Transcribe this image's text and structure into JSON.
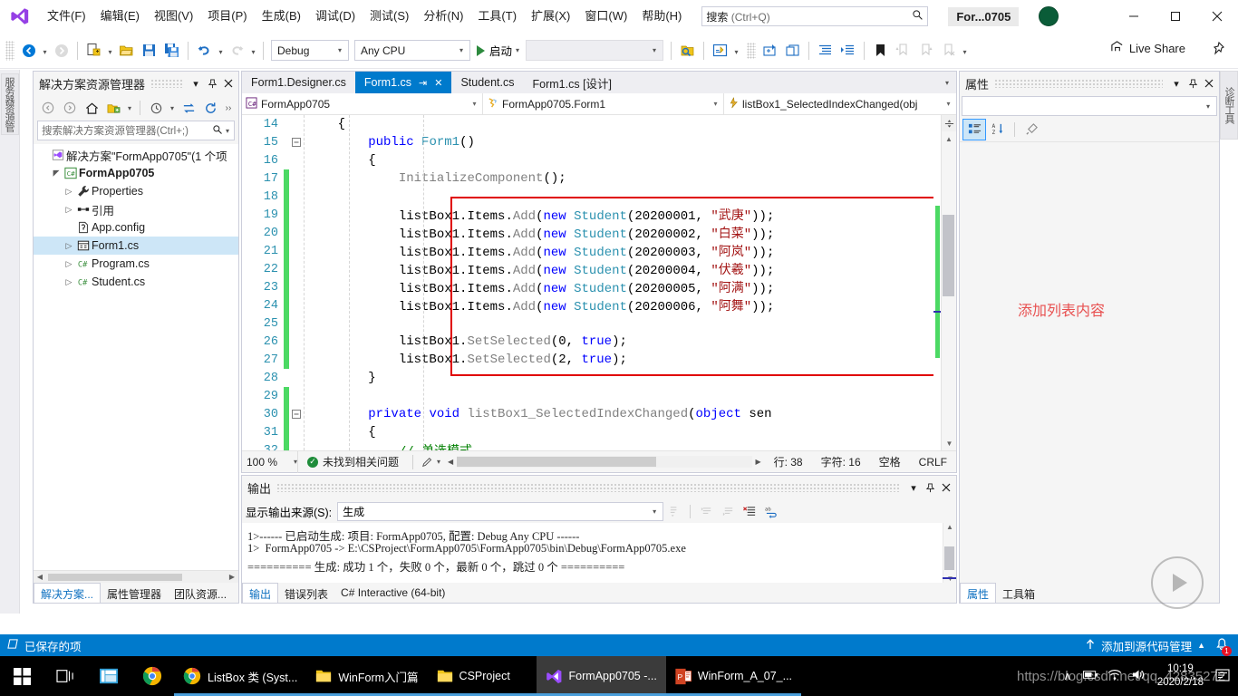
{
  "titlebar": {
    "logo_icon": "visual-studio-logo",
    "menus": [
      "文件(F)",
      "编辑(E)",
      "视图(V)",
      "项目(P)",
      "生成(B)",
      "调试(D)",
      "测试(S)",
      "分析(N)",
      "工具(T)",
      "扩展(X)",
      "窗口(W)",
      "帮助(H)"
    ],
    "search_placeholder_main": "搜索",
    "search_placeholder_hint": "(Ctrl+Q)",
    "search_icon": "search-icon",
    "project_title": "For...0705",
    "account_icon": "account-avatar",
    "minimize": "—",
    "maximize": "❐",
    "close": "✕"
  },
  "toolbar": {
    "back_icon": "navigate-back-icon",
    "forward_icon": "navigate-forward-icon",
    "new_project_icon": "new-project-icon",
    "open_icon": "open-file-icon",
    "save_icon": "save-icon",
    "save_all_icon": "save-all-icon",
    "undo_icon": "undo-icon",
    "redo_icon": "redo-icon",
    "config_value": "Debug",
    "platform_value": "Any CPU",
    "start_label": "启动",
    "start_icon": "play-icon",
    "process_value": "",
    "find_icon": "find-in-files-icon",
    "preview_icon": "preview-changes-icon",
    "step_icons": [
      "step-into-icon",
      "step-over-icon",
      "indent-icon",
      "outdent-icon",
      "bookmark-icon",
      "next-bookmark-icon",
      "prev-bookmark-icon",
      "clear-bookmark-icon"
    ],
    "live_share_label": "Live Share",
    "live_share_icon": "live-share-icon",
    "pin_icon": "pin-icon"
  },
  "left_strip": {
    "vertical_tab": "服务器资源管理器"
  },
  "solution_explorer": {
    "title": "解决方案资源管理器",
    "dropdown_icon": "chevron-down-icon",
    "pin_icon": "pin-icon",
    "close_icon": "close-icon",
    "toolbar_icons": [
      "back-icon",
      "forward-icon",
      "home-icon",
      "show-all-files-icon",
      "chevron-down-icon",
      "pending-changes-icon",
      "sync-icon",
      "refresh-icon",
      "overflow-icon"
    ],
    "search_placeholder": "搜索解决方案资源管理器(Ctrl+;)",
    "search_icon": "search-icon",
    "tree": [
      {
        "label": "解决方案\"FormApp0705\"(1 个项",
        "icon": "solution-icon",
        "indent": 0,
        "expander": "",
        "bold": false,
        "selected": false
      },
      {
        "label": "FormApp0705",
        "icon": "csharp-project-icon",
        "indent": 1,
        "expander": "▲",
        "bold": true,
        "selected": false
      },
      {
        "label": "Properties",
        "icon": "wrench-icon",
        "indent": 2,
        "expander": "▷",
        "bold": false,
        "selected": false
      },
      {
        "label": "引用",
        "icon": "references-icon",
        "indent": 2,
        "expander": "▷",
        "bold": false,
        "selected": false
      },
      {
        "label": "App.config",
        "icon": "config-file-icon",
        "indent": 2,
        "expander": "",
        "bold": false,
        "selected": false
      },
      {
        "label": "Form1.cs",
        "icon": "form-file-icon",
        "indent": 2,
        "expander": "▷",
        "bold": false,
        "selected": true
      },
      {
        "label": "Program.cs",
        "icon": "csharp-file-icon",
        "indent": 2,
        "expander": "▷",
        "bold": false,
        "selected": false
      },
      {
        "label": "Student.cs",
        "icon": "csharp-file-icon",
        "indent": 2,
        "expander": "▷",
        "bold": false,
        "selected": false
      }
    ],
    "bottom_tabs": [
      {
        "label": "解决方案...",
        "active": true
      },
      {
        "label": "属性管理器",
        "active": false
      },
      {
        "label": "团队资源...",
        "active": false
      }
    ]
  },
  "editor": {
    "doc_tabs": [
      {
        "label": "Form1.Designer.cs",
        "active": false,
        "pinned": false,
        "closable": false
      },
      {
        "label": "Form1.cs",
        "active": true,
        "pinned": true,
        "closable": true
      },
      {
        "label": "Student.cs",
        "active": false,
        "pinned": false,
        "closable": false
      },
      {
        "label": "Form1.cs [设计]",
        "active": false,
        "pinned": false,
        "closable": false
      }
    ],
    "tabs_overflow_icon": "chevron-down-icon",
    "nav_project": "FormApp0705",
    "nav_project_icon": "csharp-project-icon",
    "nav_type": "FormApp0705.Form1",
    "nav_type_icon": "class-icon",
    "nav_member": "listBox1_SelectedIndexChanged(obj",
    "nav_member_icon": "event-icon",
    "lines": [
      {
        "num": "14",
        "change": false,
        "fold": "",
        "segments": [
          {
            "t": "    {",
            "c": "k-black"
          }
        ]
      },
      {
        "num": "15",
        "change": false,
        "fold": "−",
        "segments": [
          {
            "t": "        ",
            "c": "k-black"
          },
          {
            "t": "public",
            "c": "k-blue"
          },
          {
            "t": " ",
            "c": "k-black"
          },
          {
            "t": "Form1",
            "c": "k-type"
          },
          {
            "t": "()",
            "c": "k-black"
          }
        ]
      },
      {
        "num": "16",
        "change": false,
        "fold": "",
        "segments": [
          {
            "t": "        {",
            "c": "k-black"
          }
        ]
      },
      {
        "num": "17",
        "change": true,
        "fold": "",
        "segments": [
          {
            "t": "            ",
            "c": "k-black"
          },
          {
            "t": "InitializeComponent",
            "c": "k-gray"
          },
          {
            "t": "();",
            "c": "k-black"
          }
        ]
      },
      {
        "num": "18",
        "change": true,
        "fold": "",
        "segments": [
          {
            "t": "",
            "c": "k-black"
          }
        ]
      },
      {
        "num": "19",
        "change": true,
        "fold": "",
        "segments": [
          {
            "t": "            listBox1",
            "c": "k-black"
          },
          {
            "t": ".",
            "c": "k-black"
          },
          {
            "t": "Items",
            "c": "k-black"
          },
          {
            "t": ".",
            "c": "k-black"
          },
          {
            "t": "Add",
            "c": "k-gray"
          },
          {
            "t": "(",
            "c": "k-black"
          },
          {
            "t": "new",
            "c": "k-blue"
          },
          {
            "t": " ",
            "c": "k-black"
          },
          {
            "t": "Student",
            "c": "k-type"
          },
          {
            "t": "(20200001, ",
            "c": "k-black"
          },
          {
            "t": "\"武庚\"",
            "c": "k-red"
          },
          {
            "t": "));",
            "c": "k-black"
          }
        ]
      },
      {
        "num": "20",
        "change": true,
        "fold": "",
        "segments": [
          {
            "t": "            listBox1",
            "c": "k-black"
          },
          {
            "t": ".",
            "c": "k-black"
          },
          {
            "t": "Items",
            "c": "k-black"
          },
          {
            "t": ".",
            "c": "k-black"
          },
          {
            "t": "Add",
            "c": "k-gray"
          },
          {
            "t": "(",
            "c": "k-black"
          },
          {
            "t": "new",
            "c": "k-blue"
          },
          {
            "t": " ",
            "c": "k-black"
          },
          {
            "t": "Student",
            "c": "k-type"
          },
          {
            "t": "(20200002, ",
            "c": "k-black"
          },
          {
            "t": "\"白菜\"",
            "c": "k-red"
          },
          {
            "t": "));",
            "c": "k-black"
          }
        ]
      },
      {
        "num": "21",
        "change": true,
        "fold": "",
        "segments": [
          {
            "t": "            listBox1",
            "c": "k-black"
          },
          {
            "t": ".",
            "c": "k-black"
          },
          {
            "t": "Items",
            "c": "k-black"
          },
          {
            "t": ".",
            "c": "k-black"
          },
          {
            "t": "Add",
            "c": "k-gray"
          },
          {
            "t": "(",
            "c": "k-black"
          },
          {
            "t": "new",
            "c": "k-blue"
          },
          {
            "t": " ",
            "c": "k-black"
          },
          {
            "t": "Student",
            "c": "k-type"
          },
          {
            "t": "(20200003, ",
            "c": "k-black"
          },
          {
            "t": "\"阿岚\"",
            "c": "k-red"
          },
          {
            "t": "));",
            "c": "k-black"
          }
        ]
      },
      {
        "num": "22",
        "change": true,
        "fold": "",
        "segments": [
          {
            "t": "            listBox1",
            "c": "k-black"
          },
          {
            "t": ".",
            "c": "k-black"
          },
          {
            "t": "Items",
            "c": "k-black"
          },
          {
            "t": ".",
            "c": "k-black"
          },
          {
            "t": "Add",
            "c": "k-gray"
          },
          {
            "t": "(",
            "c": "k-black"
          },
          {
            "t": "new",
            "c": "k-blue"
          },
          {
            "t": " ",
            "c": "k-black"
          },
          {
            "t": "Student",
            "c": "k-type"
          },
          {
            "t": "(20200004, ",
            "c": "k-black"
          },
          {
            "t": "\"伏羲\"",
            "c": "k-red"
          },
          {
            "t": "));",
            "c": "k-black"
          }
        ]
      },
      {
        "num": "23",
        "change": true,
        "fold": "",
        "segments": [
          {
            "t": "            listBox1",
            "c": "k-black"
          },
          {
            "t": ".",
            "c": "k-black"
          },
          {
            "t": "Items",
            "c": "k-black"
          },
          {
            "t": ".",
            "c": "k-black"
          },
          {
            "t": "Add",
            "c": "k-gray"
          },
          {
            "t": "(",
            "c": "k-black"
          },
          {
            "t": "new",
            "c": "k-blue"
          },
          {
            "t": " ",
            "c": "k-black"
          },
          {
            "t": "Student",
            "c": "k-type"
          },
          {
            "t": "(20200005, ",
            "c": "k-black"
          },
          {
            "t": "\"阿满\"",
            "c": "k-red"
          },
          {
            "t": "));",
            "c": "k-black"
          }
        ]
      },
      {
        "num": "24",
        "change": true,
        "fold": "",
        "segments": [
          {
            "t": "            listBox1",
            "c": "k-black"
          },
          {
            "t": ".",
            "c": "k-black"
          },
          {
            "t": "Items",
            "c": "k-black"
          },
          {
            "t": ".",
            "c": "k-black"
          },
          {
            "t": "Add",
            "c": "k-gray"
          },
          {
            "t": "(",
            "c": "k-black"
          },
          {
            "t": "new",
            "c": "k-blue"
          },
          {
            "t": " ",
            "c": "k-black"
          },
          {
            "t": "Student",
            "c": "k-type"
          },
          {
            "t": "(20200006, ",
            "c": "k-black"
          },
          {
            "t": "\"阿舞\"",
            "c": "k-red"
          },
          {
            "t": "));",
            "c": "k-black"
          }
        ]
      },
      {
        "num": "25",
        "change": true,
        "fold": "",
        "segments": [
          {
            "t": "",
            "c": "k-black"
          }
        ]
      },
      {
        "num": "26",
        "change": true,
        "fold": "",
        "segments": [
          {
            "t": "            listBox1",
            "c": "k-black"
          },
          {
            "t": ".",
            "c": "k-black"
          },
          {
            "t": "SetSelected",
            "c": "k-gray"
          },
          {
            "t": "(0, ",
            "c": "k-black"
          },
          {
            "t": "true",
            "c": "k-blue"
          },
          {
            "t": ");",
            "c": "k-black"
          }
        ]
      },
      {
        "num": "27",
        "change": true,
        "fold": "",
        "segments": [
          {
            "t": "            listBox1",
            "c": "k-black"
          },
          {
            "t": ".",
            "c": "k-black"
          },
          {
            "t": "SetSelected",
            "c": "k-gray"
          },
          {
            "t": "(2, ",
            "c": "k-black"
          },
          {
            "t": "true",
            "c": "k-blue"
          },
          {
            "t": ");",
            "c": "k-black"
          }
        ]
      },
      {
        "num": "28",
        "change": false,
        "fold": "",
        "segments": [
          {
            "t": "        }",
            "c": "k-black"
          }
        ]
      },
      {
        "num": "29",
        "change": true,
        "fold": "",
        "segments": [
          {
            "t": "",
            "c": "k-black"
          }
        ]
      },
      {
        "num": "30",
        "change": true,
        "fold": "−",
        "segments": [
          {
            "t": "        ",
            "c": "k-black"
          },
          {
            "t": "private",
            "c": "k-blue"
          },
          {
            "t": " ",
            "c": "k-black"
          },
          {
            "t": "void",
            "c": "k-blue"
          },
          {
            "t": " ",
            "c": "k-black"
          },
          {
            "t": "listBox1_SelectedIndexChanged",
            "c": "k-gray"
          },
          {
            "t": "(",
            "c": "k-black"
          },
          {
            "t": "object",
            "c": "k-blue"
          },
          {
            "t": " sen",
            "c": "k-black"
          }
        ]
      },
      {
        "num": "31",
        "change": true,
        "fold": "",
        "segments": [
          {
            "t": "        {",
            "c": "k-black"
          }
        ]
      },
      {
        "num": "32",
        "change": true,
        "fold": "",
        "segments": [
          {
            "t": "            ",
            "c": "k-black"
          },
          {
            "t": "// 单选模式",
            "c": "k-green"
          }
        ]
      }
    ],
    "status": {
      "zoom": "100 %",
      "zoom_arrow_icon": "chevron-down-icon",
      "issues_icon": "check-circle-icon",
      "issues": "未找到相关问题",
      "pen_icon": "pen-icon",
      "line_label": "行: 38",
      "char_label": "字符: 16",
      "space_label": "空格",
      "eol_label": "CRLF"
    }
  },
  "output": {
    "title": "输出",
    "dropdown_icon": "chevron-down-icon",
    "pin_icon": "pin-icon",
    "close_icon": "close-icon",
    "source_label": "显示输出来源(S):",
    "source_value": "生成",
    "source_arrow_icon": "chevron-down-icon",
    "toolbar_icons": [
      "jump-to-icon",
      "previous-message-icon",
      "next-message-icon",
      "clear-all-icon",
      "word-wrap-icon"
    ],
    "lines": [
      "1>------ 已启动生成: 项目: FormApp0705, 配置: Debug Any CPU ------",
      "1>  FormApp0705 -> E:\\CSProject\\FormApp0705\\FormApp0705\\bin\\Debug\\FormApp0705.exe",
      "========== 生成: 成功 1 个，失败 0 个，最新 0 个，跳过 0 个 =========="
    ],
    "bottom_tabs": [
      {
        "label": "输出",
        "active": true
      },
      {
        "label": "错误列表",
        "active": false
      },
      {
        "label": "C# Interactive (64-bit)",
        "active": false
      }
    ]
  },
  "properties": {
    "title": "属性",
    "dropdown_icon": "chevron-down-icon",
    "pin_icon": "pin-icon",
    "close_icon": "close-icon",
    "object_value": "",
    "object_arrow_icon": "chevron-down-icon",
    "toolbar_icons": [
      "categorized-icon",
      "alphabetical-icon",
      "properties-page-icon"
    ],
    "bottom_tabs": [
      {
        "label": "属性",
        "active": true
      },
      {
        "label": "工具箱",
        "active": false
      }
    ],
    "right_vertical_tab": "诊断工具"
  },
  "annotation": {
    "text": "添加列表内容",
    "color": "#e85050",
    "box_color": "#e00000"
  },
  "vs_statusbar": {
    "saved_icon": "saved-item-icon",
    "saved_label": "已保存的项",
    "source_control_icon": "upload-arrow-icon",
    "source_control_label": "添加到源代码管理",
    "source_control_arrow": "▲",
    "bell_icon": "notification-bell-icon",
    "bell_count": "1",
    "accent": "#007acc"
  },
  "taskbar": {
    "start_icon": "windows-start-icon",
    "taskview_icon": "task-view-icon",
    "apps": [
      {
        "label": "",
        "icon": "file-explorer-icon",
        "active": false,
        "running": false,
        "pinned_only": true
      },
      {
        "label": "",
        "icon": "chrome-icon",
        "active": false,
        "running": false,
        "pinned_only": true
      },
      {
        "label": "ListBox 类 (Syst...",
        "icon": "chrome-icon",
        "active": false,
        "running": true,
        "pinned_only": false
      },
      {
        "label": "WinForm入门篇",
        "icon": "folder-icon",
        "active": false,
        "running": true,
        "pinned_only": false
      },
      {
        "label": "CSProject",
        "icon": "folder-icon",
        "active": false,
        "running": true,
        "pinned_only": false
      },
      {
        "label": "FormApp0705 -...",
        "icon": "visual-studio-icon",
        "active": true,
        "running": true,
        "pinned_only": false
      },
      {
        "label": "WinForm_A_07_...",
        "icon": "powerpoint-icon",
        "active": false,
        "running": true,
        "pinned_only": false
      }
    ],
    "tray_chevron": "∧",
    "tray_icons": [
      "battery-icon",
      "wifi-icon",
      "volume-icon"
    ],
    "clock_time": "10:19",
    "clock_date": "2020/2/18",
    "notification_icon": "action-center-icon"
  },
  "watermark": {
    "text": "https://blog.csdn.net/qq_42835272",
    "play_icon": "play-overlay-icon"
  }
}
